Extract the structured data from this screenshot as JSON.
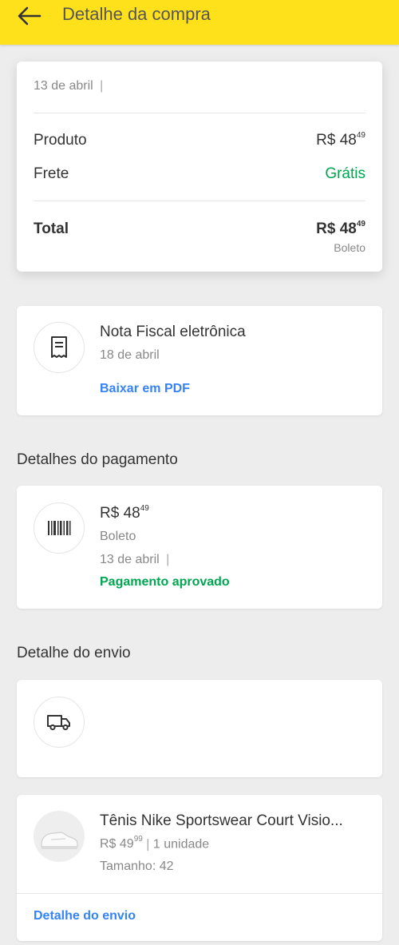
{
  "header": {
    "title": "Detalhe da compra"
  },
  "summary": {
    "date": "13 de abril",
    "product_label": "Produto",
    "product_price_main": "R$ 48",
    "product_price_cents": "49",
    "shipping_label": "Frete",
    "shipping_value": "Grátis",
    "total_label": "Total",
    "total_price_main": "R$ 48",
    "total_price_cents": "49",
    "total_method": "Boleto"
  },
  "invoice": {
    "title": "Nota Fiscal eletrônica",
    "date": "18 de abril",
    "download_link": "Baixar em PDF"
  },
  "payment": {
    "section_title": "Detalhes do pagamento",
    "amount_main": "R$ 48",
    "amount_cents": "49",
    "method": "Boleto",
    "date": "13 de abril",
    "status": "Pagamento aprovado"
  },
  "shipping": {
    "section_title": "Detalhe do envio"
  },
  "product": {
    "name": "Tênis Nike Sportswear Court Visio...",
    "price_main": "R$ 49",
    "price_cents": "99",
    "quantity": "1 unidade",
    "size": "Tamanho: 42",
    "detail_link": "Detalhe do envio"
  },
  "colors": {
    "header_bg": "#ffe11b",
    "green": "#00a650",
    "blue": "#3483fa"
  }
}
